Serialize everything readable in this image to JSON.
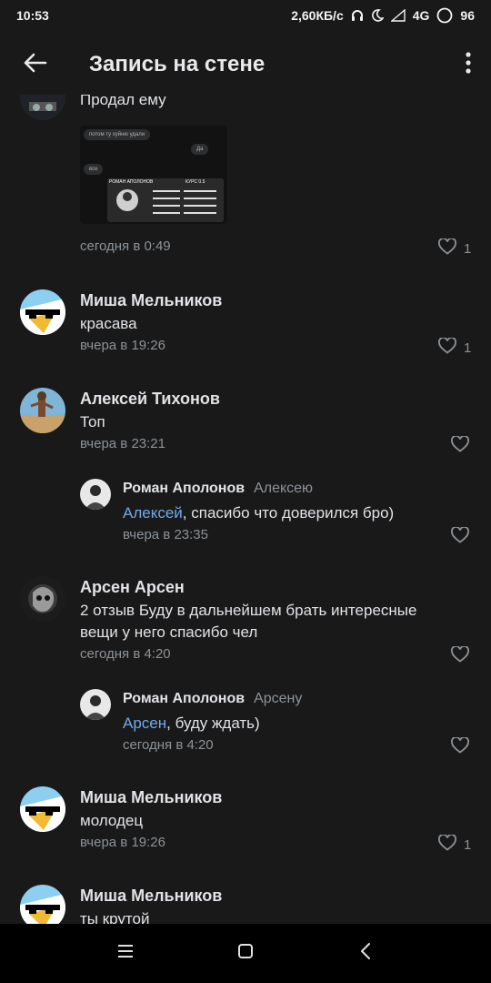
{
  "status": {
    "time": "10:53",
    "speed": "2,60КБ/с",
    "network": "4G",
    "battery": "96"
  },
  "appbar": {
    "title": "Запись на стене"
  },
  "comments": [
    {
      "text": "Продал ему",
      "time": "сегодня в 0:49",
      "likes": "1",
      "attachment": {
        "bubble1": "потом ту хуйню удали",
        "bubble2": "Да",
        "bubble3": "все",
        "banner_name": "РОМАН АПОЛОНОВ",
        "banner_title": "КУРС 0.5"
      }
    },
    {
      "author": "Миша Мельников",
      "text": "красава",
      "time": "вчера в 19:26",
      "likes": "1"
    },
    {
      "author": "Алексей Тихонов",
      "text": "Топ",
      "time": "вчера в 23:21",
      "likes": ""
    },
    {
      "author": "Роман Аполонов",
      "reply_to": "Алексею",
      "mention": "Алексей",
      "text": ", спасибо что доверился бро)",
      "time": "вчера в 23:35",
      "likes": ""
    },
    {
      "author": "Арсен Арсен",
      "text": "2 отзыв Буду в дальнейшем брать интересные вещи у него спасибо чел",
      "time": "сегодня в 4:20",
      "likes": ""
    },
    {
      "author": "Роман Аполонов",
      "reply_to": "Арсену",
      "mention": "Арсен",
      "text": ", буду ждать)",
      "time": "сегодня в 4:20",
      "likes": ""
    },
    {
      "author": "Миша Мельников",
      "text": "молодец",
      "time": "вчера в 19:26",
      "likes": "1"
    },
    {
      "author": "Миша Мельников",
      "text": "ты крутой",
      "time": "",
      "likes": ""
    }
  ],
  "icons": {
    "back": "arrow-left-icon",
    "more": "more-vertical-icon",
    "like": "heart-outline-icon",
    "nav_menu": "menu-icon",
    "nav_home": "square-icon",
    "nav_back": "chevron-left-icon"
  },
  "colors": {
    "background": "#19191a",
    "link": "#71aaeb",
    "secondary": "#8d9296",
    "navbar": "#000000"
  }
}
